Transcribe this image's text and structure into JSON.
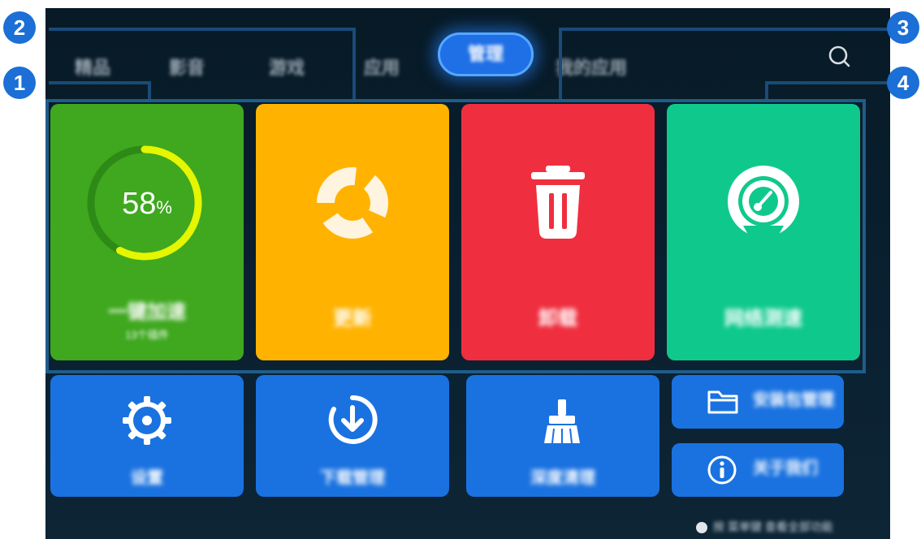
{
  "nav": {
    "tabs": [
      {
        "label": "精品"
      },
      {
        "label": "影音"
      },
      {
        "label": "游戏"
      },
      {
        "label": "应用"
      },
      {
        "label": "管理"
      },
      {
        "label": "我的应用"
      }
    ],
    "active_tab": "管理",
    "search_icon": "search-icon"
  },
  "tiles": {
    "speedup": {
      "label": "一键加速",
      "sublabel": "13个插件",
      "memory_percent": "58",
      "percent_sign": "%",
      "color": "#3fa81f"
    },
    "update": {
      "label": "更新",
      "icon": "refresh-icon",
      "color": "#ffb300"
    },
    "uninstall": {
      "label": "卸载",
      "icon": "trash-icon",
      "color": "#ef2f3f"
    },
    "net_speed": {
      "label": "网络测速",
      "icon": "speedometer-icon",
      "color": "#0fc98c"
    },
    "settings": {
      "label": "设置",
      "icon": "gear-icon",
      "color": "#1a72e0"
    },
    "downloads": {
      "label": "下载管理",
      "icon": "download-icon",
      "color": "#1a72e0"
    },
    "deep_clean": {
      "label": "深度清理",
      "icon": "broom-icon",
      "color": "#1a72e0"
    },
    "package_manager": {
      "label": "安装包管理",
      "icon": "folder-icon",
      "color": "#1a72e0"
    },
    "about": {
      "label": "关于我们",
      "icon": "info-icon",
      "color": "#1a72e0"
    }
  },
  "footer": {
    "note": "按 菜单键 查看全部功能"
  },
  "callouts": {
    "marker_1": "1",
    "marker_2": "2",
    "marker_3": "3",
    "marker_4": "4"
  },
  "colors": {
    "accent": "#1f6fe6",
    "marker": "#1b6fd6",
    "frame": "#1f5d8a"
  }
}
